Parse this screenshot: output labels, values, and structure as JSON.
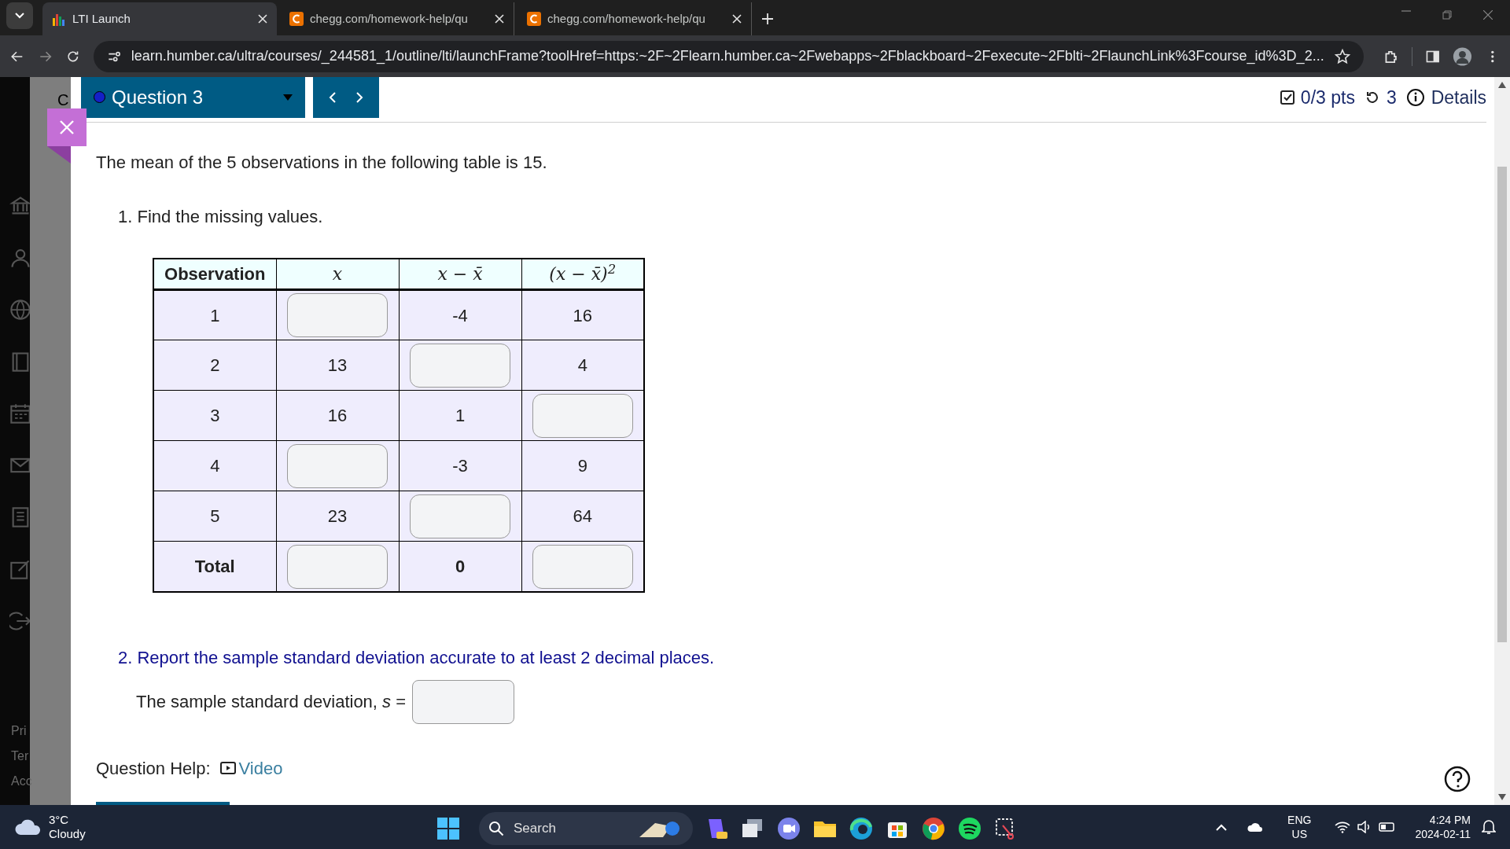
{
  "browser": {
    "tabs": [
      {
        "title": "LTI Launch",
        "selected": true,
        "kind": "chart"
      },
      {
        "title": "chegg.com/homework-help/qu",
        "selected": false,
        "kind": "chegg"
      },
      {
        "title": "chegg.com/homework-help/qu",
        "selected": false,
        "kind": "chegg"
      }
    ],
    "url": "learn.humber.ca/ultra/courses/_244581_1/outline/lti/launchFrame?toolHref=https:~2F~2Flearn.humber.ca~2Fwebapps~2Fblackboard~2Fexecute~2Fblti~2FlaunchLink%3Fcourse_id%3D_2..."
  },
  "sidebar": {
    "top_label": "C",
    "footer_links": [
      "Pri",
      "Ter",
      "Acc"
    ]
  },
  "question_header": {
    "title": "Question 3",
    "score": "0/3 pts",
    "attempts": "3",
    "details": "Details"
  },
  "question": {
    "intro": "The mean of the 5 observations in the following table is 15.",
    "part1": "1. Find the missing values.",
    "table": {
      "columns": [
        "Observation",
        "x",
        "x − x̄",
        "(x − x̄)$^{2}$"
      ],
      "rows": [
        {
          "kind": "data",
          "cells": [
            {
              "kind": "text",
              "text": "1"
            },
            {
              "kind": "input"
            },
            {
              "kind": "text",
              "text": "-4"
            },
            {
              "kind": "text",
              "text": "16"
            }
          ]
        },
        {
          "kind": "data",
          "cells": [
            {
              "kind": "text",
              "text": "2"
            },
            {
              "kind": "text",
              "text": "13"
            },
            {
              "kind": "input"
            },
            {
              "kind": "text",
              "text": "4"
            }
          ]
        },
        {
          "kind": "data",
          "cells": [
            {
              "kind": "text",
              "text": "3"
            },
            {
              "kind": "text",
              "text": "16"
            },
            {
              "kind": "text",
              "text": "1"
            },
            {
              "kind": "input"
            }
          ]
        },
        {
          "kind": "data",
          "cells": [
            {
              "kind": "text",
              "text": "4"
            },
            {
              "kind": "input"
            },
            {
              "kind": "text",
              "text": "-3"
            },
            {
              "kind": "text",
              "text": "9"
            }
          ]
        },
        {
          "kind": "data",
          "cells": [
            {
              "kind": "text",
              "text": "5"
            },
            {
              "kind": "text",
              "text": "23"
            },
            {
              "kind": "input"
            },
            {
              "kind": "text",
              "text": "64"
            }
          ]
        },
        {
          "kind": "total",
          "cells": [
            {
              "kind": "text",
              "text": "Total"
            },
            {
              "kind": "input"
            },
            {
              "kind": "text",
              "text": "0"
            },
            {
              "kind": "input"
            }
          ]
        }
      ]
    },
    "part2": "2. Report the sample standard deviation accurate to at least 2 decimal places.",
    "answer_label": "The sample standard deviation, *s* ="
  },
  "help": {
    "label": "Question Help:",
    "link": "Video"
  },
  "taskbar": {
    "temperature": "3°C",
    "weather": "Cloudy",
    "search_placeholder": "Search",
    "language": "ENG",
    "region": "US",
    "time": "4:24 PM",
    "date": "2024-02-11"
  }
}
